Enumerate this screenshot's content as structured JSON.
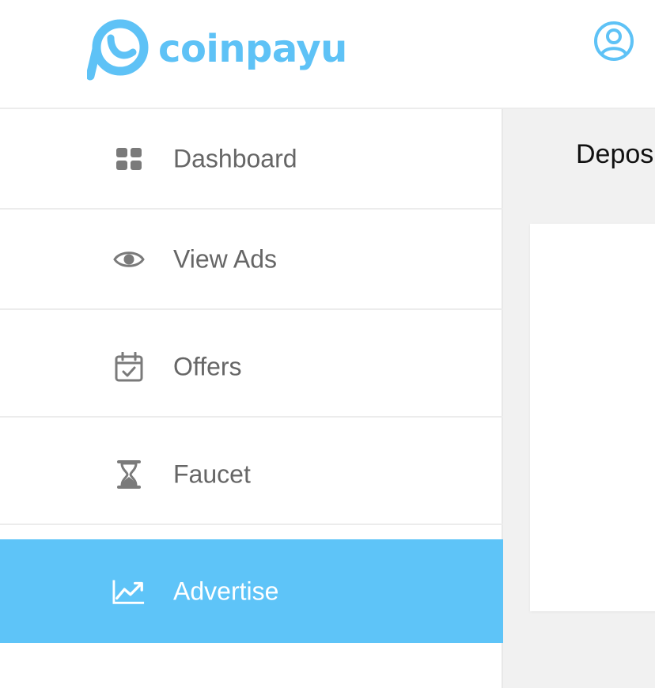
{
  "brand": {
    "name": "coinpayu",
    "color": "#5ec2f6"
  },
  "header": {
    "user_icon": "user-circle-icon"
  },
  "sidebar": {
    "active_color": "#5ec4f8",
    "items": [
      {
        "label": "Dashboard",
        "icon": "dashboard-grid-icon",
        "active": false
      },
      {
        "label": "View Ads",
        "icon": "eye-icon",
        "active": false
      },
      {
        "label": "Offers",
        "icon": "calendar-check-icon",
        "active": false
      },
      {
        "label": "Faucet",
        "icon": "hourglass-icon",
        "active": false
      },
      {
        "label": "Advertise",
        "icon": "trending-chart-icon",
        "active": true
      }
    ]
  },
  "main": {
    "title": "Deposit"
  }
}
